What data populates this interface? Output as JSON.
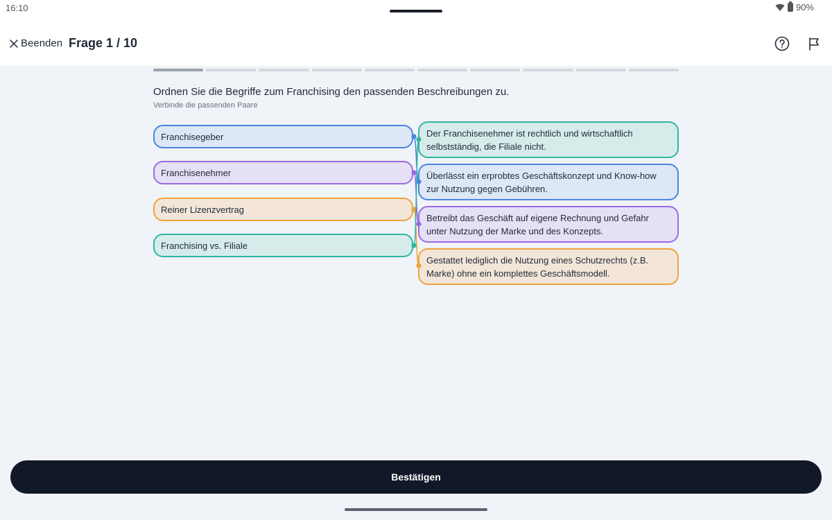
{
  "status": {
    "time": "16:10",
    "battery": "90%"
  },
  "header": {
    "quit_label": "Beenden",
    "title": "Frage 1 / 10"
  },
  "progress": {
    "current": 1,
    "total": 10
  },
  "question": {
    "text": "Ordnen Sie die Begriffe zum Franchising den passenden Beschreibungen zu.",
    "hint": "Verbinde die passenden Paare"
  },
  "terms": [
    {
      "label": "Franchisegeber",
      "color": "#4a86e0"
    },
    {
      "label": "Franchisenehmer",
      "color": "#9a6ae0"
    },
    {
      "label": "Reiner Lizenzvertrag",
      "color": "#f0a43c"
    },
    {
      "label": "Franchising vs. Filiale",
      "color": "#2fb5a4"
    }
  ],
  "descriptions": [
    {
      "text": "Der Franchisenehmer ist rechtlich und wirtschaftlich selbstständig, die Filiale nicht.",
      "color": "#2fb5a4"
    },
    {
      "text": "Überlässt ein erprobtes Geschäftskonzept und Know-how zur Nutzung gegen Gebühren.",
      "color": "#4a86e0"
    },
    {
      "text": "Betreibt das Geschäft auf eigene Rechnung und Gefahr unter Nutzung der Marke und des Konzepts.",
      "color": "#9a6ae0"
    },
    {
      "text": "Gestattet lediglich die Nutzung eines Schutzrechts (z.B. Marke) ohne ein komplettes Geschäftsmodell.",
      "color": "#f0a43c"
    }
  ],
  "connections": [
    {
      "term": 0,
      "description": 1
    },
    {
      "term": 1,
      "description": 2
    },
    {
      "term": 2,
      "description": 3
    },
    {
      "term": 3,
      "description": 0
    }
  ],
  "footer": {
    "confirm_label": "Bestätigen"
  }
}
